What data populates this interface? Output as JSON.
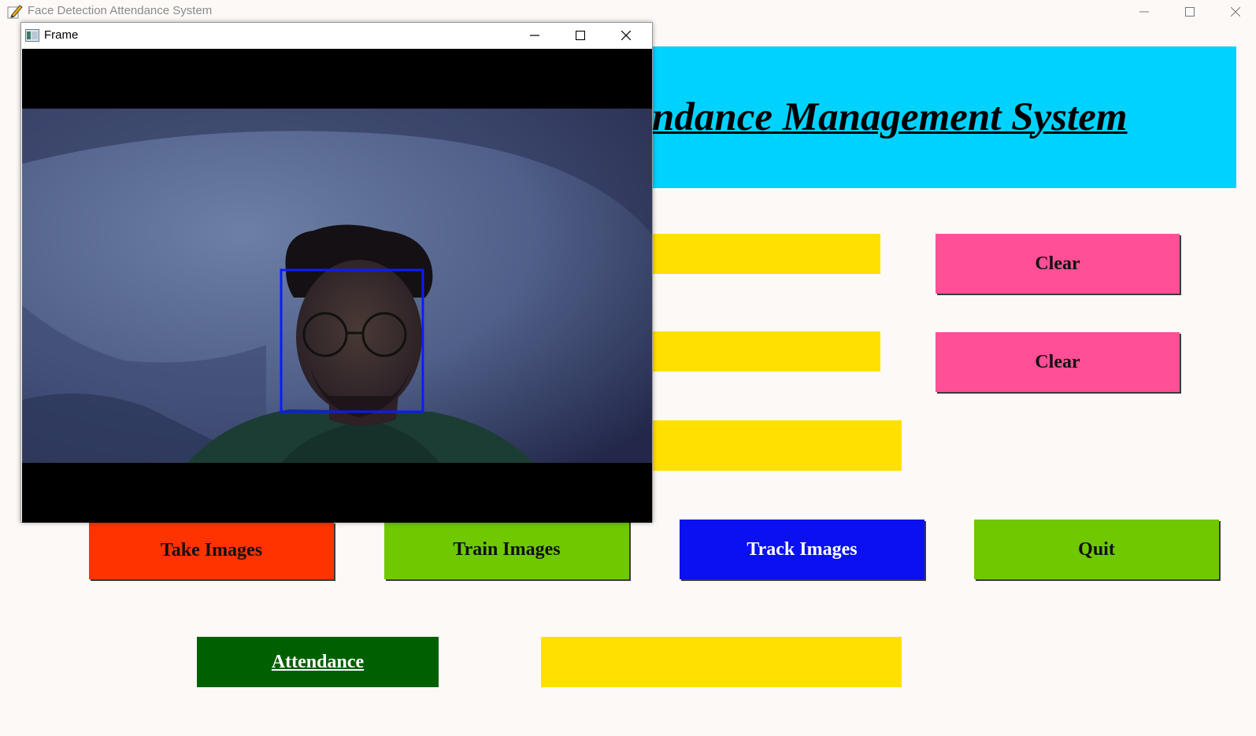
{
  "app": {
    "window_title": "Face Detection Attendance System"
  },
  "header": {
    "title": "ndance Management System"
  },
  "buttons": {
    "clear_1": "Clear",
    "clear_2": "Clear",
    "take_images": "Take Images",
    "train_images": "Train Images",
    "track_images": "Track Images",
    "quit": "Quit",
    "attendance": "Attendance"
  },
  "frame_window": {
    "title": "Frame"
  },
  "icons": {
    "app": "pencil-icon",
    "frame": "window-icon",
    "minimize": "minimize-icon",
    "maximize": "maximize-icon",
    "close": "close-icon"
  },
  "colors": {
    "banner": "#00d2ff",
    "field": "#ffe000",
    "clear": "#ff4f96",
    "take": "#ff3300",
    "train": "#6fc800",
    "track": "#0a10f2",
    "quit": "#6fc800",
    "attendance": "#006000",
    "face_box": "#0a1cff"
  }
}
